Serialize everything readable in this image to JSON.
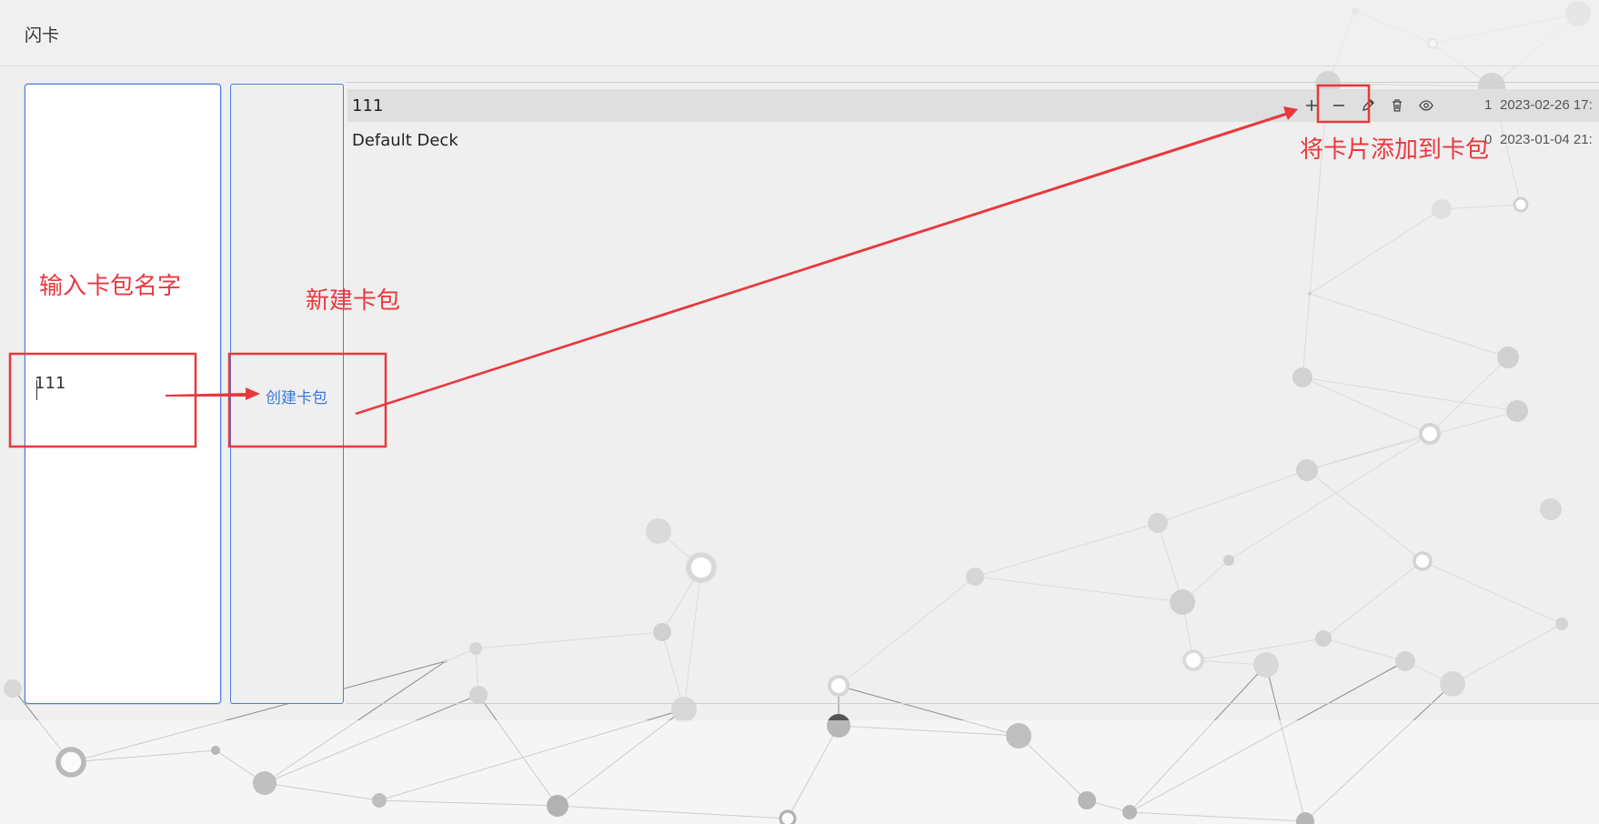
{
  "app": {
    "title": "闪卡"
  },
  "input": {
    "value": "111"
  },
  "create_button": {
    "label": "创建卡包"
  },
  "decks": [
    {
      "name": "111",
      "count": "1",
      "date": "2023-02-26 17:",
      "active": true
    },
    {
      "name": "Default Deck",
      "count": "0",
      "date": "2023-01-04 21:",
      "active": false
    }
  ],
  "annotations": {
    "input_hint": "输入卡包名字",
    "create_hint": "新建卡包",
    "add_hint": "将卡片添加到卡包"
  },
  "colors": {
    "accent": "#3a78d8",
    "annotation": "#e8383d",
    "panel_border": "#4a7fd6"
  },
  "icons": [
    "plus-icon",
    "minus-icon",
    "pencil-icon",
    "trash-icon",
    "eye-icon"
  ]
}
